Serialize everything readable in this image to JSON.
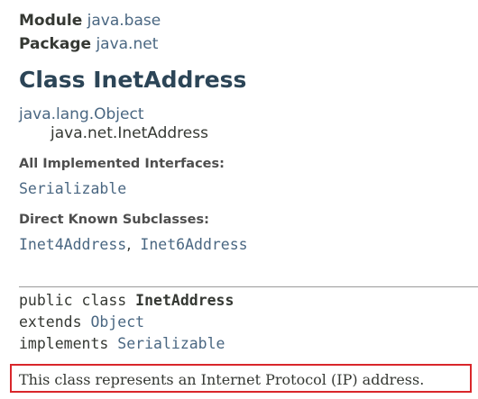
{
  "header": {
    "module_label": "Module",
    "module_name": "java.base",
    "package_label": "Package",
    "package_name": "java.net",
    "class_title": "Class InetAddress"
  },
  "inheritance": {
    "parent": "java.lang.Object",
    "child": "java.net.InetAddress"
  },
  "implemented_interfaces": {
    "title": "All Implemented Interfaces:",
    "items": [
      "Serializable"
    ]
  },
  "direct_known_subclasses": {
    "title": "Direct Known Subclasses:",
    "items": [
      "Inet4Address",
      "Inet6Address"
    ],
    "separator": ","
  },
  "signature": {
    "modifiers": "public class",
    "class_name": "InetAddress",
    "extends_keyword": "extends",
    "extends_type": "Object",
    "implements_keyword": "implements",
    "implements_type": "Serializable"
  },
  "description": {
    "text": "This class represents an Internet Protocol (IP) address.",
    "highlight_color": "#d9262b"
  },
  "colors": {
    "link": "#4a6782",
    "title": "#2c4557",
    "text": "#353833"
  }
}
